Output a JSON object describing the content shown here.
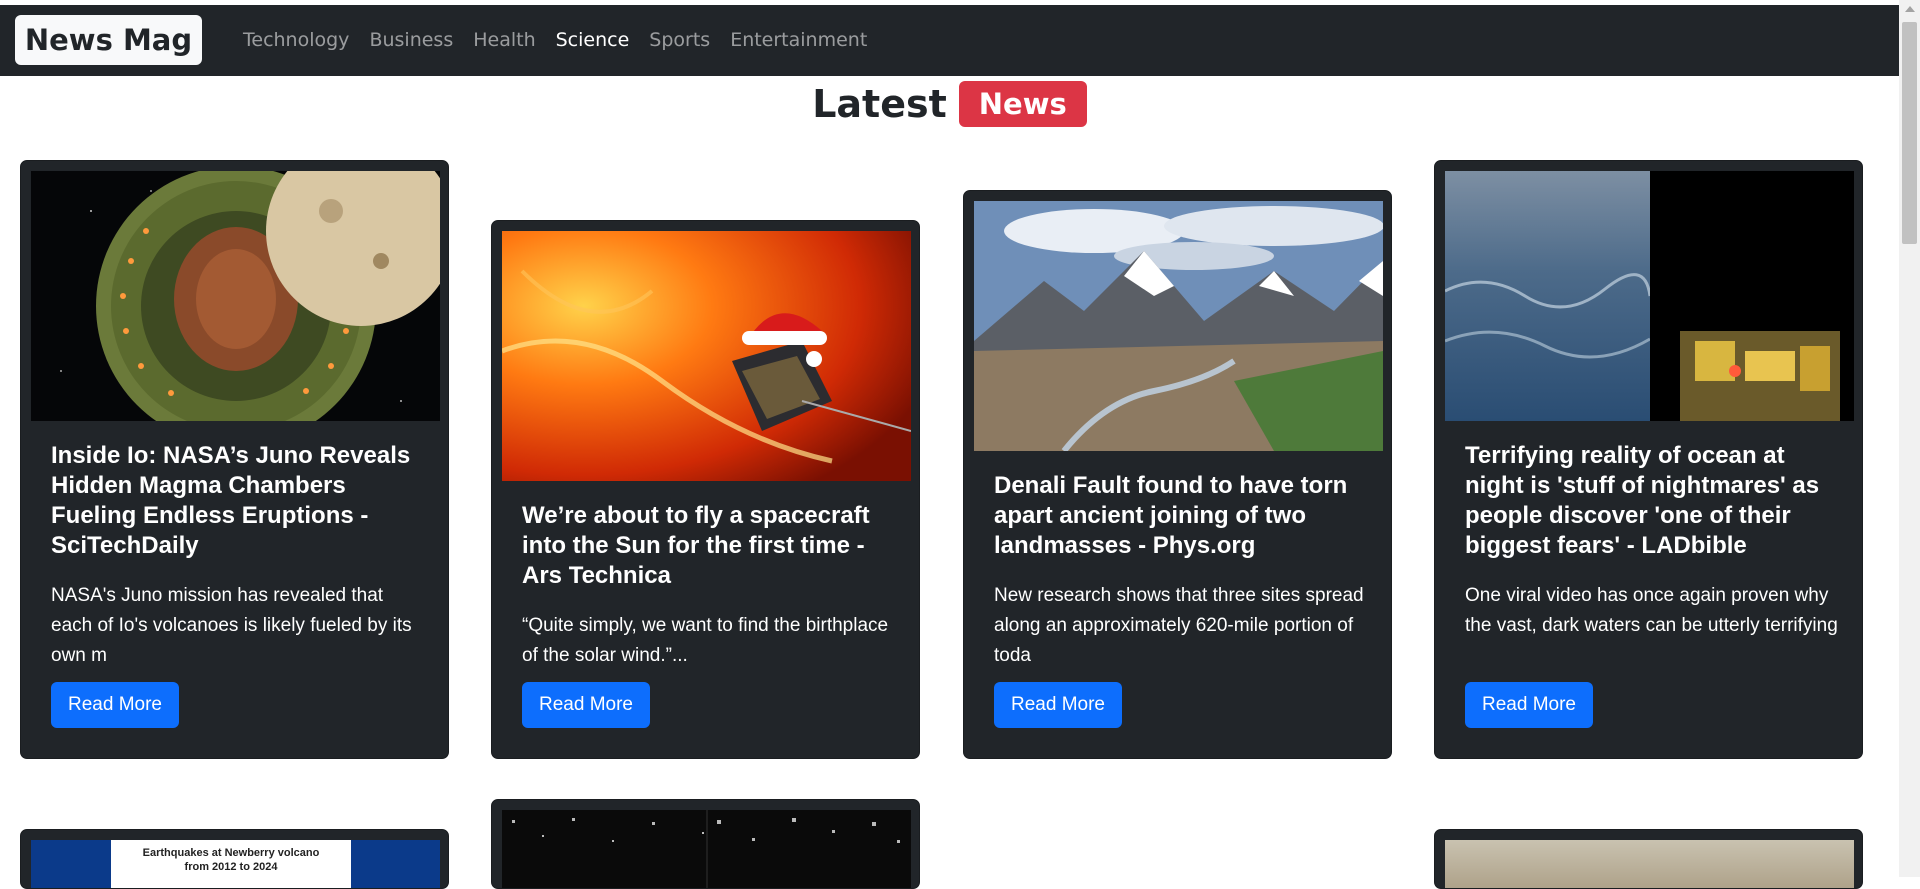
{
  "navbar": {
    "brand": "News Mag",
    "links": [
      {
        "label": "Technology",
        "active": false
      },
      {
        "label": "Business",
        "active": false
      },
      {
        "label": "Health",
        "active": false
      },
      {
        "label": "Science",
        "active": true
      },
      {
        "label": "Sports",
        "active": false
      },
      {
        "label": "Entertainment",
        "active": false
      }
    ]
  },
  "heading": {
    "text": "Latest",
    "badge": "News"
  },
  "cards": [
    {
      "title": "Inside Io: NASA’s Juno Reveals Hidden Magma Chambers Fueling Endless Eruptions - SciTechDaily",
      "description": "NASA's Juno mission has revealed that each of Io's volcanoes is likely fueled by its own m",
      "button": "Read More",
      "image_icon": "io-moon-image"
    },
    {
      "title": "We’re about to fly a spacecraft into the Sun for the first time - Ars Technica",
      "description": "“Quite simply, we want to find the birthplace of the solar wind.”...",
      "button": "Read More",
      "image_icon": "sun-probe-image"
    },
    {
      "title": "Denali Fault found to have torn apart ancient joining of two landmasses - Phys.org",
      "description": "New research shows that three sites spread along an approximately 620-mile portion of toda",
      "button": "Read More",
      "image_icon": "mountains-image"
    },
    {
      "title": "Terrifying reality of ocean at night is 'stuff of nightmares' as people discover 'one of their biggest fears' - LADbible",
      "description": "One viral video has once again proven why the vast, dark waters can be utterly terrifying",
      "button": "Read More",
      "image_icon": "ocean-night-image"
    }
  ],
  "partial_cards": [
    {
      "image_icon": "earthquake-chart-image",
      "caption_line1": "Earthquakes at Newberry volcano",
      "caption_line2": "from 2012 to 2024"
    },
    {
      "image_icon": "noise-image"
    },
    {
      "image_icon": "landscape-image"
    }
  ]
}
